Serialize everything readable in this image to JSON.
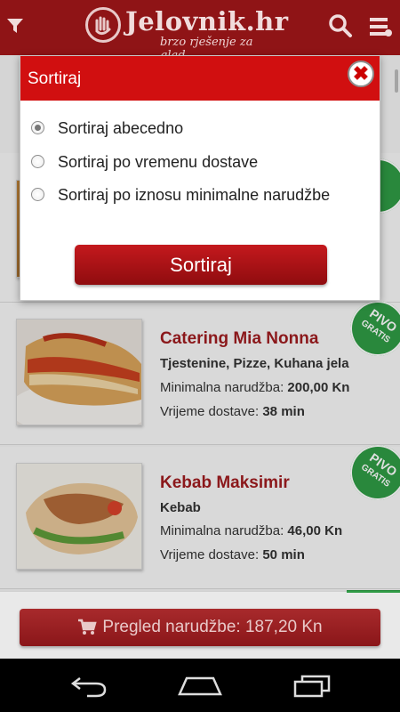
{
  "header": {
    "brand": "Jelovnik.hr",
    "tagline": "brzo rješenje za glad",
    "icons": [
      "filter-icon",
      "search-icon",
      "menu-icon"
    ]
  },
  "restaurants": [
    {
      "name": "Catering Mia Nonna",
      "cuisine": "Tjestenine, Pizze, Kuhana jela",
      "min_label": "Minimalna narudžba:",
      "min_value": "200,00 Kn",
      "time_label": "Vrijeme dostave:",
      "time_value": "38 min",
      "badge": {
        "line1": "PIVO",
        "line2": "GRATIS"
      }
    },
    {
      "name": "Kebab Maksimir",
      "cuisine": "Kebab",
      "min_label": "Minimalna narudžba:",
      "min_value": "46,00 Kn",
      "time_label": "Vrijeme dostave:",
      "time_value": "50 min",
      "badge": {
        "line1": "PIVO",
        "line2": "GRATIS"
      }
    }
  ],
  "cart": {
    "label": "Pregled narudžbe: 187,20 Kn"
  },
  "dialog": {
    "title": "Sortiraj",
    "options": [
      {
        "label": "Sortiraj abecedno",
        "selected": true
      },
      {
        "label": "Sortiraj po vremenu dostave",
        "selected": false
      },
      {
        "label": "Sortiraj po iznosu minimalne narudžbe",
        "selected": false
      }
    ],
    "button": "Sortiraj"
  },
  "colors": {
    "brand_red": "#8f1416",
    "dialog_red": "#d10f10",
    "badge_green": "#2f9b45",
    "title_red": "#9f1c1f"
  }
}
